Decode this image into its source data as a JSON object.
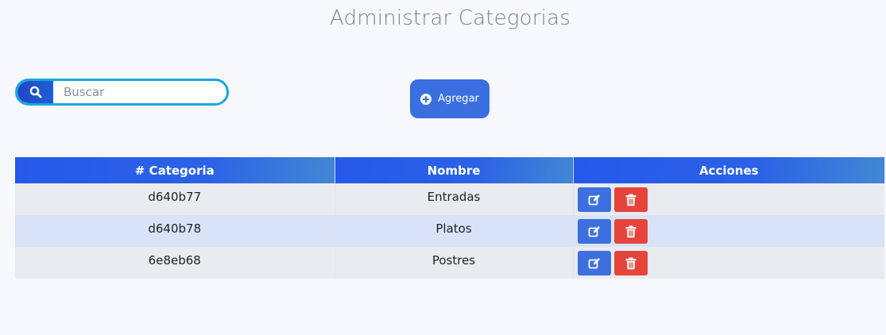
{
  "page": {
    "title": "Administrar Categorias"
  },
  "search": {
    "placeholder": "Buscar",
    "value": "",
    "icon": "search-icon"
  },
  "add_button": {
    "label": "Agregar",
    "icon": "plus-circle-icon"
  },
  "table": {
    "headers": [
      "# Categoria",
      "Nombre",
      "Acciones"
    ],
    "rows": [
      {
        "id": "d640b77",
        "name": "Entradas"
      },
      {
        "id": "d640b78",
        "name": "Platos"
      },
      {
        "id": "6e8eb68",
        "name": "Postres"
      }
    ],
    "actions": {
      "edit_icon": "edit-icon",
      "delete_icon": "trash-icon"
    }
  },
  "colors": {
    "primary": "#3b6fdf",
    "header_gradient_start": "#2459eb",
    "header_gradient_end": "#4288d4",
    "danger": "#e5443a",
    "search_border": "#16a8dc",
    "title": "#7b7f8c"
  }
}
